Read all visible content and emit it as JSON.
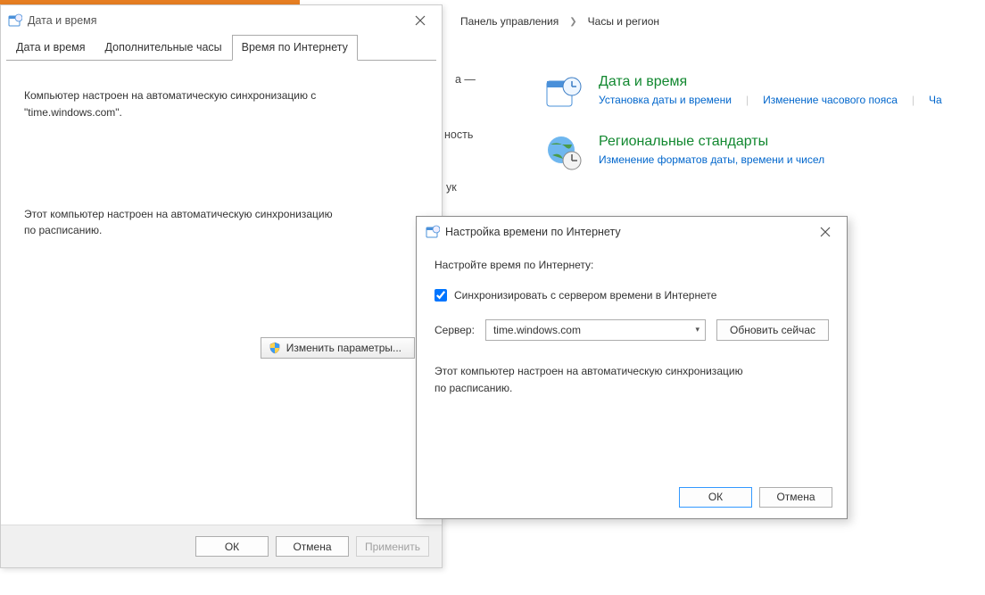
{
  "breadcrumb": {
    "parent": "Панель управления",
    "current": "Часы и регион"
  },
  "cp": {
    "datetime": {
      "title": "Дата и время",
      "link1": "Установка даты и времени",
      "link2": "Изменение часового пояса",
      "link3": "Ча"
    },
    "region": {
      "title": "Региональные стандарты",
      "link1": "Изменение форматов даты, времени и чисел"
    }
  },
  "peek": {
    "l1": "а —",
    "l2": "ность",
    "l3": "ук"
  },
  "dlg1": {
    "title": "Дата и время",
    "tabs": {
      "t1": "Дата и время",
      "t2": "Дополнительные часы",
      "t3": "Время по Интернету"
    },
    "p1a": "Компьютер настроен на автоматическую синхронизацию с",
    "p1b": "\"time.windows.com\".",
    "p2a": "Этот компьютер настроен на автоматическую синхронизацию",
    "p2b": "по расписанию.",
    "changeBtn": "Изменить параметры...",
    "ok": "ОК",
    "cancel": "Отмена",
    "apply": "Применить"
  },
  "dlg2": {
    "title": "Настройка времени по Интернету",
    "lead": "Настройте время по Интернету:",
    "chk": "Синхронизировать с сервером времени в Интернете",
    "serverLabel": "Сервер:",
    "serverValue": "time.windows.com",
    "update": "Обновить сейчас",
    "p2a": "Этот компьютер настроен на автоматическую синхронизацию",
    "p2b": "по расписанию.",
    "ok": "ОК",
    "cancel": "Отмена"
  }
}
